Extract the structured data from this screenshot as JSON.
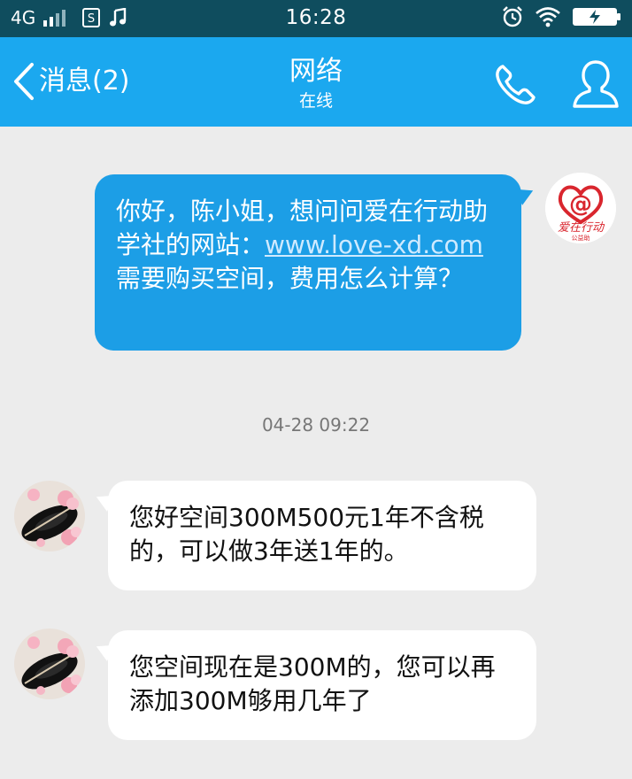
{
  "status_bar": {
    "network": "4G",
    "time": "16:28"
  },
  "header": {
    "back_label": "消息(2)",
    "title": "网络",
    "subtitle": "在线"
  },
  "messages": [
    {
      "direction": "outgoing",
      "text_before_link": "你好，陈小姐，想问问爱在行动助学社的网站：",
      "link": "www.love-xd.com",
      "text_after_link": "需要购买空间，费用怎么计算？"
    },
    {
      "direction": "incoming",
      "text": "您好空间300M500元1年不含税的，可以做3年送1年的。"
    },
    {
      "direction": "incoming",
      "text": "您空间现在是300M的，您可以再添加300M够用几年了"
    }
  ],
  "timestamp": "04-28 09:22",
  "self_avatar": {
    "logo_text": "爱在行动",
    "logo_subtext": "公益助"
  },
  "colors": {
    "status_bar": "#0f4d5e",
    "header": "#1ba8ef",
    "outgoing_bubble": "#1c9ee6",
    "incoming_bubble": "#ffffff",
    "background": "#ececec"
  }
}
